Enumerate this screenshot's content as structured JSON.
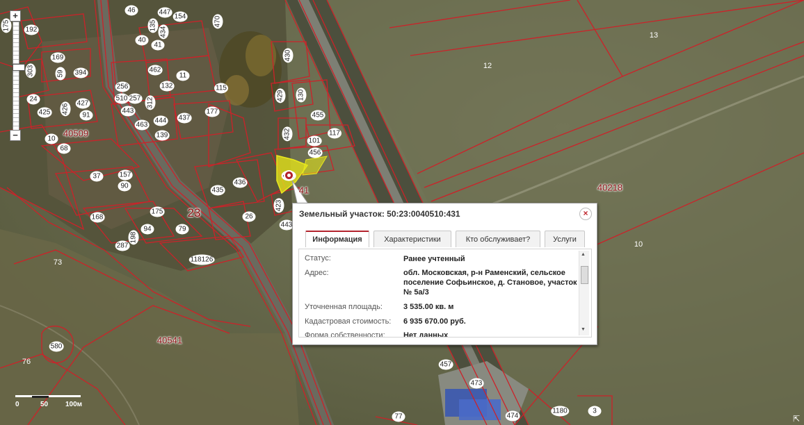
{
  "map": {
    "zoom": {
      "plus": "+",
      "minus": "−"
    },
    "scale": {
      "zero": "0",
      "mid": "50",
      "end": "100м"
    },
    "block_labels": [
      "40509",
      "40218",
      "40541",
      "23",
      "41"
    ],
    "parcel_labels": [
      "46",
      "447",
      "154",
      "192",
      "175",
      "169",
      "394",
      "59",
      "303",
      "256",
      "510",
      "257",
      "312",
      "24",
      "425",
      "427",
      "426",
      "91",
      "443",
      "463",
      "444",
      "139",
      "437",
      "10",
      "68",
      "37",
      "157",
      "90",
      "168",
      "175",
      "94",
      "79",
      "287",
      "198",
      "118126",
      "73",
      "580",
      "76",
      "77",
      "474",
      "473",
      "457",
      "1180",
      "3",
      "13",
      "12",
      "10",
      "135",
      "470",
      "434",
      "40",
      "41",
      "462",
      "11",
      "132",
      "115",
      "430",
      "429",
      "130",
      "455",
      "177",
      "432",
      "101",
      "117",
      "456",
      "436",
      "435",
      "423",
      "26",
      "443",
      "431"
    ],
    "colors": {
      "boundary": "#cc2229",
      "selected_fill": "#e3e21a"
    }
  },
  "popup": {
    "title": "Земельный участок: 50:23:0040510:431",
    "close": "×",
    "tabs": [
      "Информация",
      "Характеристики",
      "Кто обслуживает?",
      "Услуги"
    ],
    "active_tab": "Информация",
    "rows": [
      {
        "label": "Статус:",
        "value": "Ранее учтенный"
      },
      {
        "label": "Адрес:",
        "value": "обл. Московская, р-н Раменский, сельское поселение Софьинское, д. Становое, участок № 5а/3"
      },
      {
        "label": "Уточненная площадь:",
        "value": "3 535.00 кв. м"
      },
      {
        "label": "Кадастровая стоимость:",
        "value": "6 935 670.00 руб."
      },
      {
        "label": "Форма собственности:",
        "value": "Нет данных"
      }
    ]
  },
  "icons": {
    "marker": "location-pin-icon",
    "close": "close-icon",
    "resize": "resize-corner-icon"
  }
}
